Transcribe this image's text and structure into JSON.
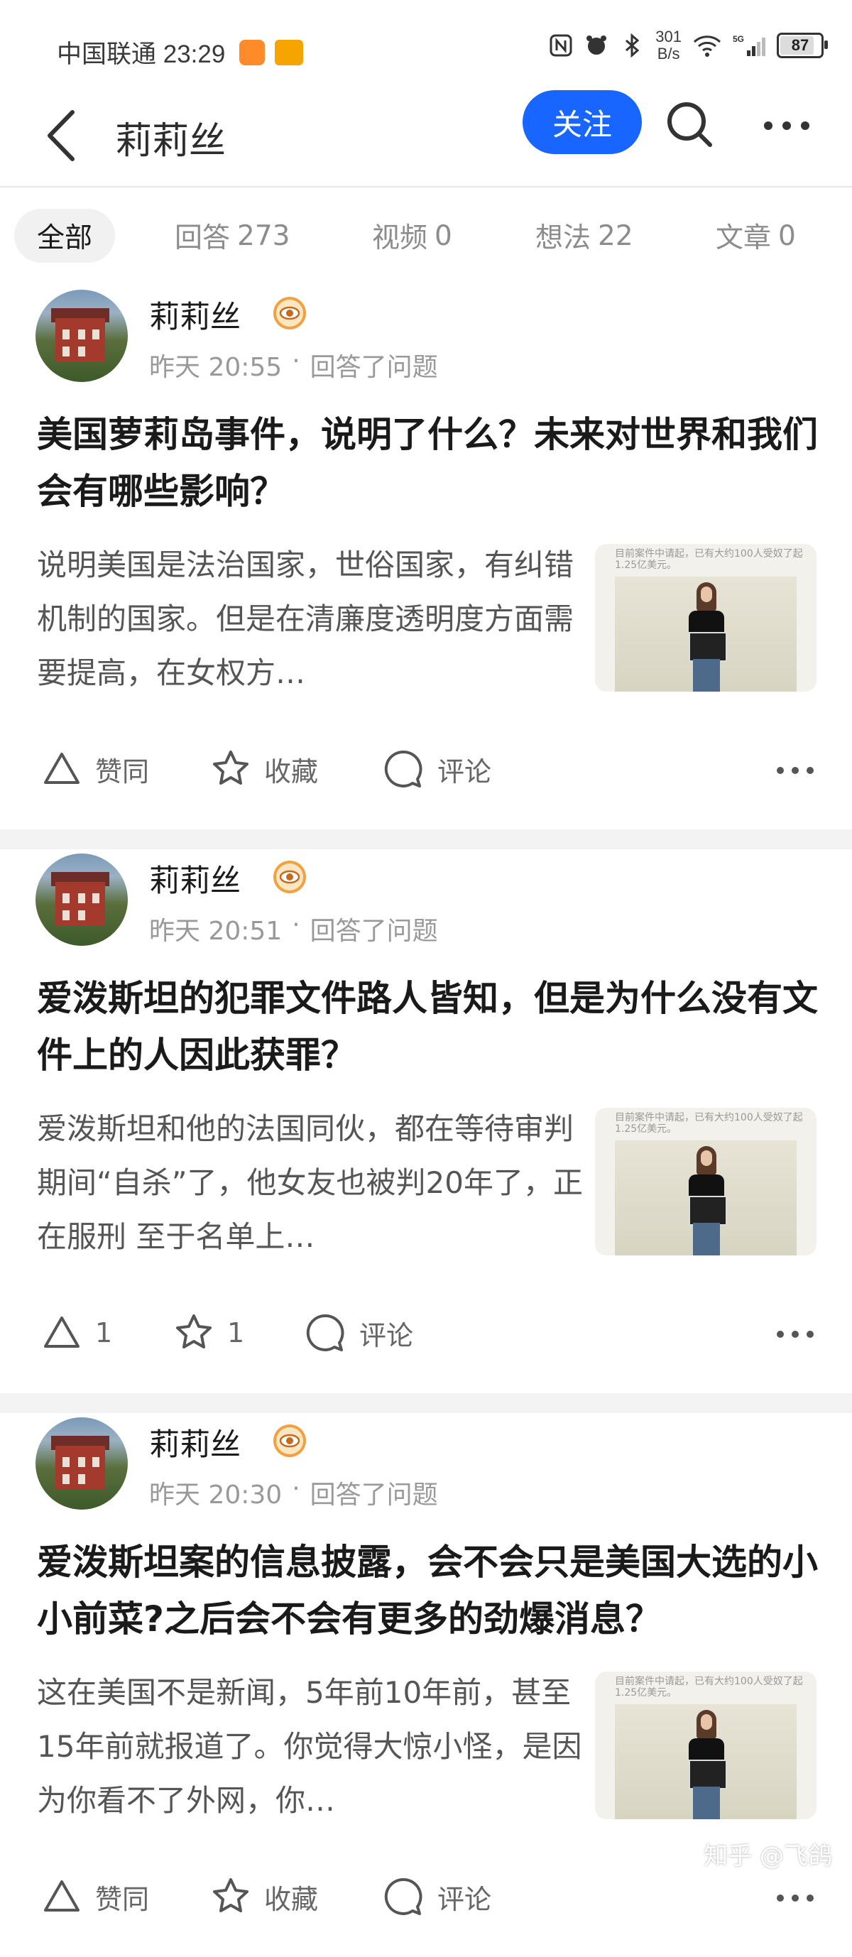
{
  "status_bar": {
    "carrier_time": "中国联通 23:29",
    "net_speed_value": "301",
    "net_speed_unit": "B/s",
    "net_type": "5G",
    "battery": "87",
    "battery_level": 0.87
  },
  "nav": {
    "title": "莉莉丝",
    "follow_label": "关注",
    "accent_color": "#1866ff"
  },
  "tabs": [
    {
      "label": "全部",
      "count": ""
    },
    {
      "label": "回答",
      "count": "273"
    },
    {
      "label": "视频",
      "count": "0"
    },
    {
      "label": "想法",
      "count": "22"
    },
    {
      "label": "文章",
      "count": "0"
    }
  ],
  "cards": [
    {
      "author": "莉莉丝",
      "time": "昨天 20:55",
      "action": "回答了问题",
      "title": "美国萝莉岛事件，说明了什么？未来对世界和我们会有哪些影响？",
      "excerpt": "说明美国是法治国家，世俗国家，有纠错机制的国家。但是在清廉度透明度方面需要提高，在女权方…",
      "thumb_caption": "目前案件中请起，已有大约100人受奴了起1.25亿美元。",
      "upvote": "赞同",
      "favorite": "收藏",
      "comment": "评论"
    },
    {
      "author": "莉莉丝",
      "time": "昨天 20:51",
      "action": "回答了问题",
      "title": "爱泼斯坦的犯罪文件路人皆知，但是为什么没有文件上的人因此获罪？",
      "excerpt": "爱泼斯坦和他的法国同伙，都在等待审判期间“自杀”了，他女友也被判20年了，正在服刑 至于名单上…",
      "thumb_caption": "目前案件中请起，已有大约100人受奴了起1.25亿美元。",
      "upvote": "1",
      "favorite": "1",
      "comment": "评论"
    },
    {
      "author": "莉莉丝",
      "time": "昨天 20:30",
      "action": "回答了问题",
      "title": "爱泼斯坦案的信息披露，会不会只是美国大选的小小前菜?之后会不会有更多的劲爆消息？",
      "excerpt": "这在美国不是新闻，5年前10年前，甚至15年前就报道了。你觉得大惊小怪，是因为你看不了外网，你…",
      "thumb_caption": "目前案件中请起，已有大约100人受奴了起1.25亿美元。",
      "upvote": "赞同",
      "favorite": "收藏",
      "comment": "评论"
    }
  ],
  "watermark": "知乎 @飞鸽"
}
